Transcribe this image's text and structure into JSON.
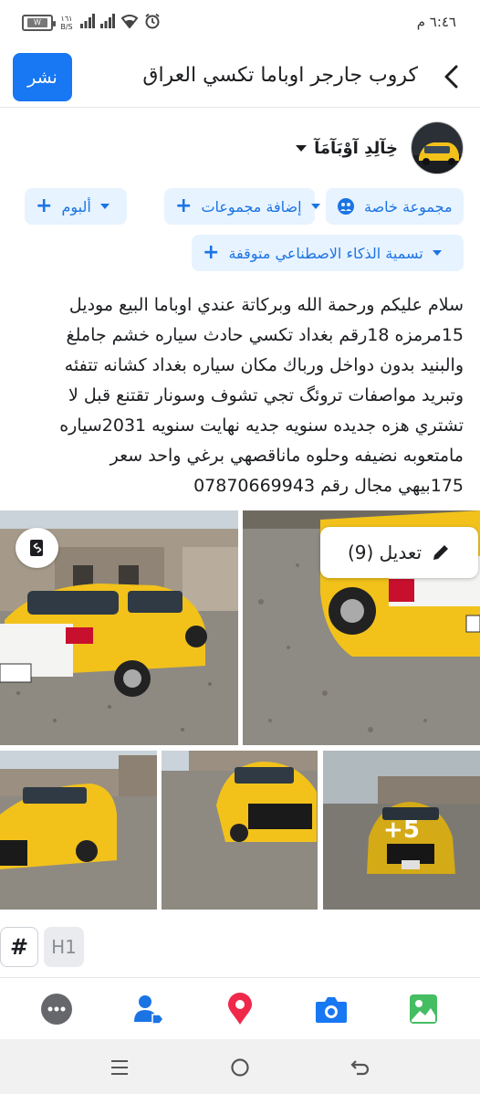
{
  "status_bar": {
    "time": "٦:٤٦ م",
    "battery_label": "W",
    "net_speed": "١٦١",
    "net_unit": "B/S"
  },
  "header": {
    "title": "كروب جارجر اوباما تكسي العراق",
    "post_label": "نشر",
    "back_icon": "chevron-left-icon"
  },
  "author": {
    "name": "خِآلِدِ آوْبَآمَآ"
  },
  "chips": {
    "privacy": "مجموعة خاصة",
    "add_groups": "إضافة مجموعات",
    "album": "ألبوم",
    "ai_label": "تسمية الذكاء الاصطناعي متوقفة"
  },
  "post": {
    "lines": [
      "سلام عليكم ورحمة الله وبركاتة عندي اوباما البيع موديل",
      "15مرمزه 18رقم بغداد تكسي حادث سياره خشم جاملغ",
      "والبنيد بدون دواخل ورباك مكان سياره بغداد كشانه تتفئه",
      "وتبريد مواصفات تروئگ تجي تشوف وسونار تقتنع قبل لا",
      "تشتري هزه جديده سنويه جديه نهايت سنويه 2031سياره",
      "مامتعوبه نضيفه وحلوه ماناقصهي برغي واحد سعر",
      "175بيهي مجال رقم 07870669943"
    ]
  },
  "photos": {
    "edit_label": "تعديل (9)",
    "more_label": "+5"
  },
  "formatting": {
    "hash": "#",
    "h1": "H1"
  },
  "colors": {
    "accent": "#1877f2",
    "chip_bg": "#e7f3ff",
    "chip_text": "#1b74e4",
    "taxi_yellow": "#f2c21b",
    "tag_icon": "#1b74e4",
    "location_icon": "#f0284a",
    "camera_icon": "#1877f2",
    "photo_icon": "#45bd62"
  }
}
